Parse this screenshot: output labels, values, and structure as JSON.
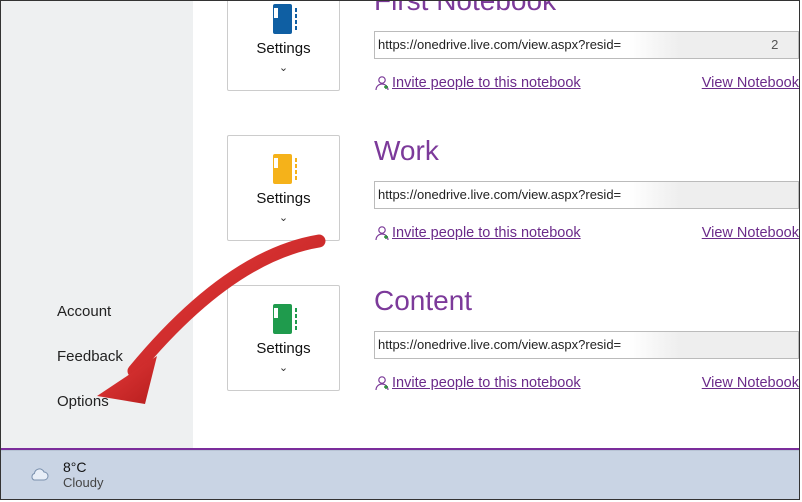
{
  "sidebar": {
    "items": [
      {
        "label": "Account"
      },
      {
        "label": "Feedback"
      },
      {
        "label": "Options"
      }
    ]
  },
  "notebooks": [
    {
      "name": "First Notebook",
      "color": "#0f5fa3",
      "settings_label": "Settings",
      "url_text": "https://onedrive.live.com/view.aspx?resid=",
      "url_tail": "2",
      "invite": "Invite people to this notebook",
      "view": "View Notebook"
    },
    {
      "name": "Work",
      "color": "#f5b21a",
      "settings_label": "Settings",
      "url_text": "https://onedrive.live.com/view.aspx?resid=",
      "url_tail": "",
      "invite": "Invite people to this notebook",
      "view": "View Notebook"
    },
    {
      "name": "Content",
      "color": "#1f9b4d",
      "settings_label": "Settings",
      "url_text": "https://onedrive.live.com/view.aspx?resid=",
      "url_tail": "",
      "invite": "Invite people to this notebook",
      "view": "View Notebook"
    }
  ],
  "taskbar": {
    "temperature": "8°C",
    "condition": "Cloudy"
  },
  "annotation_arrow": {
    "target": "Options"
  }
}
